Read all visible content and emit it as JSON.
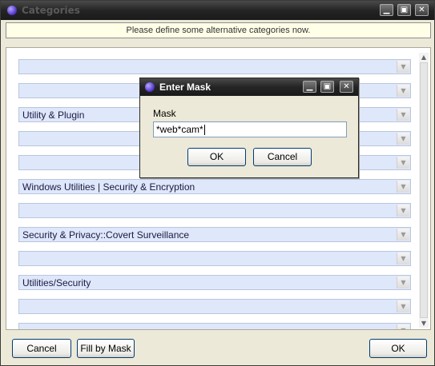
{
  "window": {
    "title": "Categories",
    "controls": [
      "minimize",
      "maximize",
      "close"
    ]
  },
  "banner": {
    "text": "Please define some alternative categories now."
  },
  "category_rows": [
    {
      "text": ""
    },
    {
      "text": ""
    },
    {
      "text": "Utility & Plugin"
    },
    {
      "text": ""
    },
    {
      "text": ""
    },
    {
      "text": "Windows Utilities  |  Security & Encryption"
    },
    {
      "text": ""
    },
    {
      "text": "Security & Privacy::Covert Surveillance"
    },
    {
      "text": ""
    },
    {
      "text": "Utilities/Security"
    },
    {
      "text": ""
    },
    {
      "text": ""
    }
  ],
  "footer": {
    "cancel_label": "Cancel",
    "fill_by_mask_label": "Fill by Mask",
    "ok_label": "OK"
  },
  "dialog": {
    "title": "Enter Mask",
    "mask_label": "Mask",
    "mask_value": "*web*cam*",
    "ok_label": "OK",
    "cancel_label": "Cancel"
  },
  "icons": {
    "minimize": "minimize-icon",
    "maximize": "maximize-icon",
    "close": "close-icon",
    "dropdown": "chevron-down-icon",
    "app": "app-icon"
  }
}
